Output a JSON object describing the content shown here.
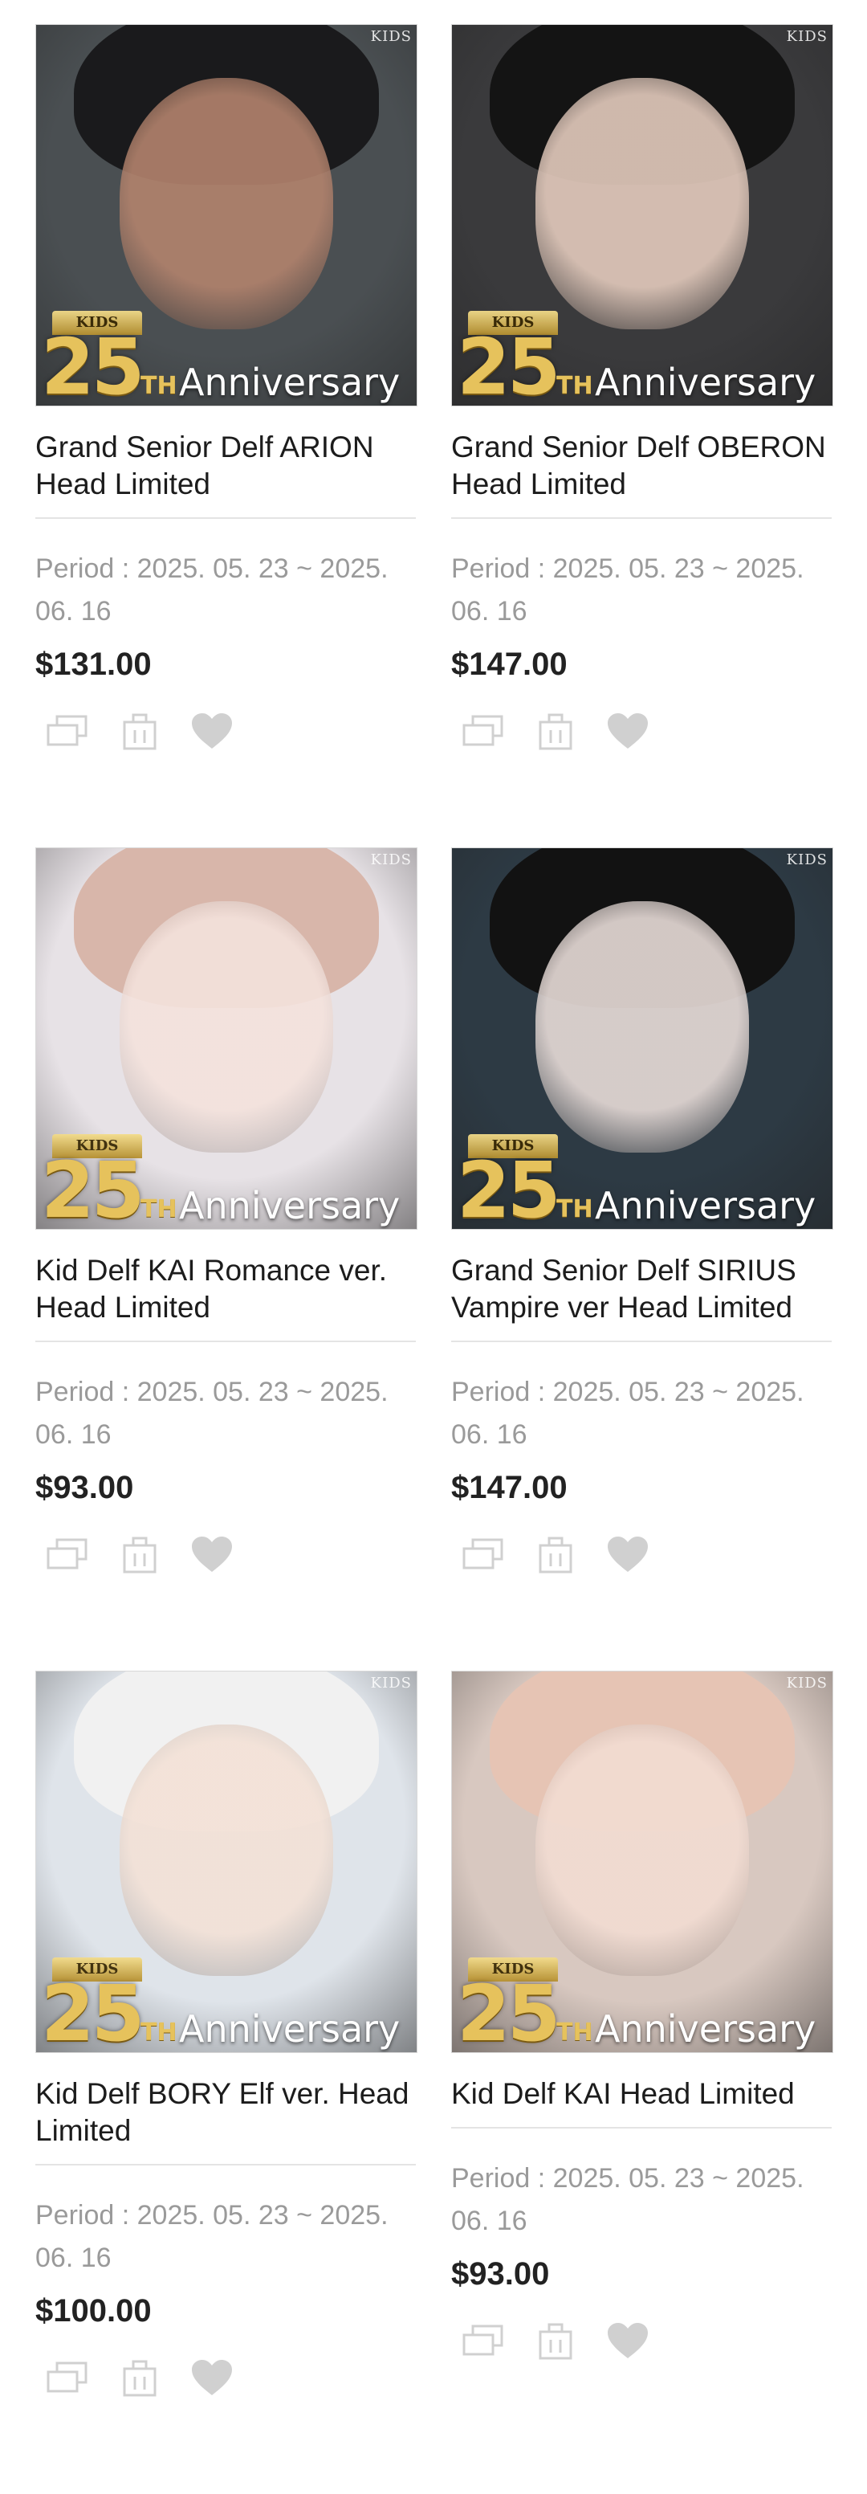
{
  "products": [
    {
      "title": "Grand Senior Delf ARION Head Limited",
      "period": "Period : 2025. 05. 23 ~ 2025. 06. 16",
      "price": "$131.00",
      "image": {
        "brand": "KIDS",
        "badge_crest": "KIDS",
        "badge_number": "25",
        "badge_suffix": "TH",
        "badge_text": "Anniversary",
        "bg": "#4a4f52",
        "hair": "#1a1a1c",
        "skin": "#b3836d"
      }
    },
    {
      "title": "Grand Senior Delf OBERON Head Limited",
      "period": "Period : 2025. 05. 23 ~ 2025. 06. 16",
      "price": "$147.00",
      "image": {
        "brand": "KIDS",
        "badge_crest": "KIDS",
        "badge_number": "25",
        "badge_suffix": "TH",
        "badge_text": "Anniversary",
        "bg": "#3a3a3c",
        "hair": "#141414",
        "skin": "#e4cbbd"
      }
    },
    {
      "title": "Kid Delf KAI Romance ver. Head Limited",
      "period": "Period : 2025. 05. 23 ~ 2025. 06. 16",
      "price": "$93.00",
      "image": {
        "brand": "KIDS",
        "badge_crest": "KIDS",
        "badge_number": "25",
        "badge_suffix": "TH",
        "badge_text": "Anniversary",
        "bg": "#e7e2e6",
        "hair": "#d8b6aa",
        "skin": "#f4e2dc"
      }
    },
    {
      "title": "Grand Senior Delf SIRIUS Vampire ver Head Limited",
      "period": "Period : 2025. 05. 23 ~ 2025. 06. 16",
      "price": "$147.00",
      "image": {
        "brand": "KIDS",
        "badge_crest": "KIDS",
        "badge_number": "25",
        "badge_suffix": "TH",
        "badge_text": "Anniversary",
        "bg": "#2d3a44",
        "hair": "#121212",
        "skin": "#e8dcd8"
      }
    },
    {
      "title": "Kid Delf BORY Elf ver. Head Limited",
      "period": "Period : 2025. 05. 23 ~ 2025. 06. 16",
      "price": "$100.00",
      "image": {
        "brand": "KIDS",
        "badge_crest": "KIDS",
        "badge_number": "25",
        "badge_suffix": "TH",
        "badge_text": "Anniversary",
        "bg": "#dfe4ea",
        "hair": "#f1f1f1",
        "skin": "#f3e1d6"
      }
    },
    {
      "title": "Kid Delf KAI Head Limited",
      "period": "Period : 2025. 05. 23 ~ 2025. 06. 16",
      "price": "$93.00",
      "image": {
        "brand": "KIDS",
        "badge_crest": "KIDS",
        "badge_number": "25",
        "badge_suffix": "TH",
        "badge_text": "Anniversary",
        "bg": "#d8c8c0",
        "hair": "#e6c4b4",
        "skin": "#f2dcd2"
      }
    }
  ],
  "actions": [
    {
      "icon": "compare-icon"
    },
    {
      "icon": "cart-bag-icon"
    },
    {
      "icon": "heart-icon"
    }
  ],
  "colors": {
    "text": "#1c1c1c",
    "muted": "#9a9a9a",
    "icon": "#d0d0d0",
    "divider": "#e4e4e4",
    "gold": "#e6c25c"
  }
}
